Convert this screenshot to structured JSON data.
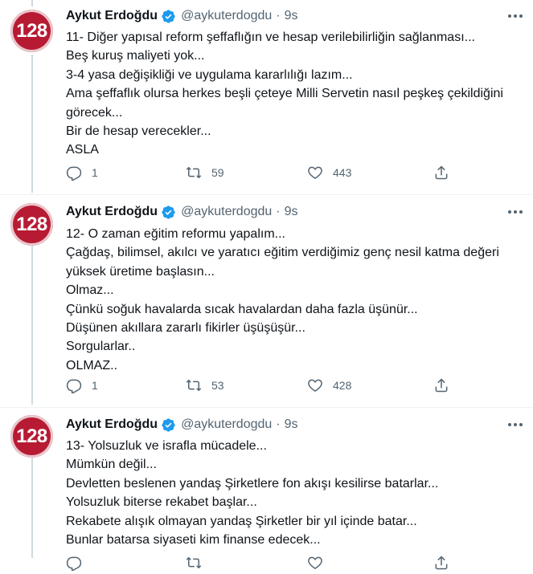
{
  "tweets": [
    {
      "avatar_text": "128",
      "name": "Aykut Erdoğdu",
      "handle": "@aykuterdogdu",
      "separator": "·",
      "time": "9s",
      "lines": [
        "11- Diğer yapısal reform şeffaflığın ve hesap verilebilirliğin sağlanması...",
        "Beş kuruş maliyeti yok...",
        "3-4 yasa değişikliği ve uygulama kararlılığı lazım...",
        "Ama şeffaflık olursa herkes beşli çeteye Milli Servetin nasıl peşkeş çekildiğini",
        "görecek...",
        "Bir de hesap verecekler...",
        "ASLA"
      ],
      "replies": "1",
      "retweets": "59",
      "likes": "443"
    },
    {
      "avatar_text": "128",
      "name": "Aykut Erdoğdu",
      "handle": "@aykuterdogdu",
      "separator": "·",
      "time": "9s",
      "lines": [
        "12- O zaman eğitim reformu yapalım...",
        "Çağdaş, bilimsel, akılcı ve yaratıcı eğitim verdiğimiz genç nesil katma değeri",
        "yüksek üretime başlasın...",
        "Olmaz...",
        "Çünkü soğuk havalarda sıcak havalardan daha fazla üşünür...",
        "Düşünen akıllara zararlı fikirler üşüşüşür...",
        "Sorgularlar..",
        "OLMAZ.."
      ],
      "replies": "1",
      "retweets": "53",
      "likes": "428"
    },
    {
      "avatar_text": "128",
      "name": "Aykut Erdoğdu",
      "handle": "@aykuterdogdu",
      "separator": "·",
      "time": "9s",
      "lines": [
        "13- Yolsuzluk ve israfla mücadele...",
        "Mümkün değil...",
        "Devletten beslenen yandaş Şirketlere fon akışı kesilirse batarlar...",
        "Yolsuzluk biterse rekabet başlar...",
        "Rekabete alışık olmayan yandaş Şirketler bir yıl içinde batar...",
        "Bunlar batarsa siyaseti kim finanse edecek..."
      ],
      "replies": "",
      "retweets": "",
      "likes": ""
    }
  ],
  "icons": {
    "verified": "verified-badge-icon",
    "more": "more-horizontal-icon",
    "reply": "reply-icon",
    "retweet": "retweet-icon",
    "like": "heart-icon",
    "share": "share-icon"
  },
  "colors": {
    "avatar": "#b71b33",
    "verified": "#1d9bf0",
    "muted": "#536471",
    "divider": "#eff3f4",
    "thread": "#cfd9de"
  }
}
